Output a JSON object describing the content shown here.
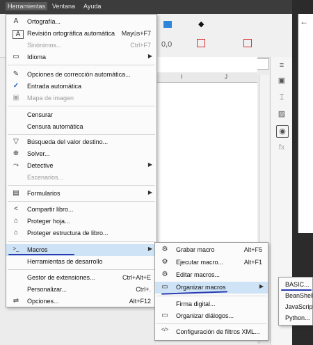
{
  "menubar": [
    {
      "label": "Herramientas",
      "selected": true
    },
    {
      "label": "Ventana",
      "selected": false
    },
    {
      "label": "Ayuda",
      "selected": false
    }
  ],
  "colors": {
    "accent": "#1f5fbf",
    "annotation": "#2a3bb0",
    "highlight": "#cfe3f6"
  },
  "columns": [
    "I",
    "J"
  ],
  "main_menu": [
    {
      "label": "Ortografía...",
      "icon": "A",
      "shortcut": "",
      "disabled": false
    },
    {
      "label": "Revisión ortográfica automática",
      "icon": "A",
      "shortcut": "Mayús+F7",
      "disabled": false
    },
    {
      "label": "Sinónimos...",
      "icon": "",
      "shortcut": "Ctrl+F7",
      "disabled": true
    },
    {
      "label": "Idioma",
      "icon": "▭",
      "shortcut": "",
      "disabled": false,
      "submenu": true
    },
    {
      "label": "Opciones de corrección automática...",
      "icon": "✎",
      "shortcut": "",
      "disabled": false
    },
    {
      "label": "Entrada automática",
      "icon": "✓",
      "shortcut": "",
      "disabled": false
    },
    {
      "label": "Mapa de imagen",
      "icon": "▣",
      "shortcut": "",
      "disabled": true
    },
    {
      "label": "Censurar",
      "icon": "",
      "shortcut": "",
      "disabled": false
    },
    {
      "label": "Censura automática",
      "icon": "",
      "shortcut": "",
      "disabled": false
    },
    {
      "label": "Búsqueda del valor destino...",
      "icon": "▽",
      "shortcut": "",
      "disabled": false
    },
    {
      "label": "Solver...",
      "icon": "⊕",
      "shortcut": "",
      "disabled": false
    },
    {
      "label": "Detective",
      "icon": "⤳",
      "shortcut": "",
      "disabled": false,
      "submenu": true
    },
    {
      "label": "Escenarios...",
      "icon": "",
      "shortcut": "",
      "disabled": true
    },
    {
      "label": "Formularios",
      "icon": "▤",
      "shortcut": "",
      "disabled": false,
      "submenu": true
    },
    {
      "label": "Compartir libro...",
      "icon": "<",
      "shortcut": "",
      "disabled": false
    },
    {
      "label": "Proteger hoja...",
      "icon": "⌂",
      "shortcut": "",
      "disabled": false
    },
    {
      "label": "Proteger estructura de libro...",
      "icon": "⌂",
      "shortcut": "",
      "disabled": false
    },
    {
      "label": "Macros",
      "icon": ">_",
      "shortcut": "",
      "disabled": false,
      "submenu": true
    },
    {
      "label": "Herramientas de desarrollo",
      "icon": "",
      "shortcut": "",
      "disabled": false
    },
    {
      "label": "Gestor de extensiones...",
      "icon": "",
      "shortcut": "Ctrl+Alt+E",
      "disabled": false
    },
    {
      "label": "Personalizar...",
      "icon": "",
      "shortcut": "Ctrl+.",
      "disabled": false
    },
    {
      "label": "Opciones...",
      "icon": "⇌",
      "shortcut": "Alt+F12",
      "disabled": false
    }
  ],
  "macros_menu": [
    {
      "label": "Grabar macro",
      "icon": "⚙",
      "shortcut": "Alt+F5"
    },
    {
      "label": "Ejecutar macro...",
      "icon": "⚙",
      "shortcut": "Alt+F1"
    },
    {
      "label": "Editar macros...",
      "icon": "⚙",
      "shortcut": ""
    },
    {
      "label": "Organizar macros",
      "icon": "▭",
      "shortcut": "",
      "submenu": true
    },
    {
      "label": "Firma digital...",
      "icon": "",
      "shortcut": ""
    },
    {
      "label": "Organizar diálogos...",
      "icon": "▭",
      "shortcut": ""
    },
    {
      "label": "Configuración de filtros XML...",
      "icon": "</>",
      "shortcut": ""
    }
  ],
  "organize_menu": [
    {
      "label": "BASIC..."
    },
    {
      "label": "BeanShell..."
    },
    {
      "label": "JavaScript..."
    },
    {
      "label": "Python..."
    }
  ]
}
